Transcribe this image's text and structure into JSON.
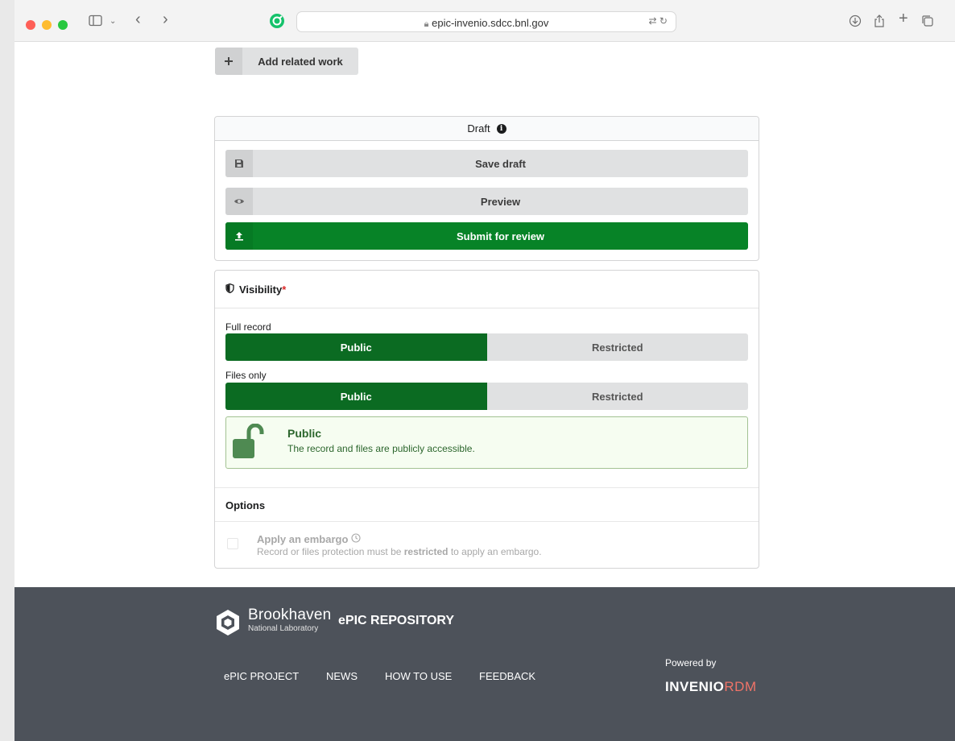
{
  "browser": {
    "url": "epic-invenio.sdcc.bnl.gov",
    "traffic_colors": [
      "#fe5f57",
      "#febc2e",
      "#28c840"
    ]
  },
  "related": {
    "add_label": "Add related work"
  },
  "draft_panel": {
    "title": "Draft",
    "save_label": "Save draft",
    "preview_label": "Preview",
    "submit_label": "Submit for review"
  },
  "visibility": {
    "title": "Visibility",
    "required_mark": "*",
    "full_record_label": "Full record",
    "files_only_label": "Files only",
    "full_record_options": [
      "Public",
      "Restricted"
    ],
    "files_options": [
      "Public",
      "Restricted"
    ],
    "selected_full_record": "Public",
    "selected_files": "Public",
    "status_title": "Public",
    "status_desc": "The record and files are publicly accessible.",
    "options_title": "Options",
    "embargo_title": "Apply an embargo",
    "embargo_desc_prefix": "Record or files protection must be",
    "embargo_desc_bold": "restricted",
    "embargo_desc_suffix": "to apply an embargo."
  },
  "footer": {
    "org_name": "Brookhaven",
    "org_sub": "National Laboratory",
    "repo_name": "ePIC REPOSITORY",
    "links": [
      "ePIC PROJECT",
      "NEWS",
      "HOW TO USE",
      "FEEDBACK"
    ],
    "powered_by": "Powered by",
    "invenio_main": "INVENIO",
    "invenio_rdm": "RDM"
  },
  "colors": {
    "submit_green": "#078327",
    "toggle_green": "#0b6b22",
    "footer_bg": "#4d525a",
    "rdm_accent": "#f07368"
  }
}
